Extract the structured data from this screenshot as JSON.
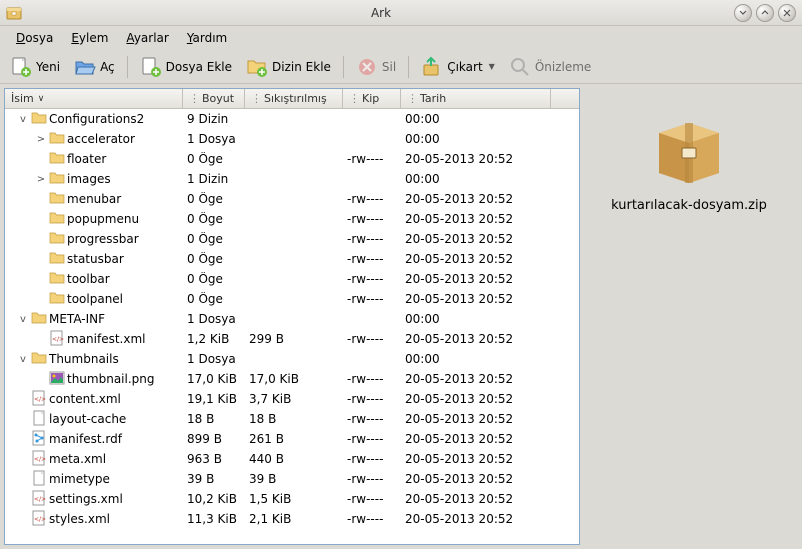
{
  "title": "Ark",
  "menubar": [
    "Dosya",
    "Eylem",
    "Ayarlar",
    "Yardım"
  ],
  "toolbar": {
    "new": "Yeni",
    "open": "Aç",
    "addfile": "Dosya Ekle",
    "adddir": "Dizin Ekle",
    "delete": "Sil",
    "extract": "Çıkart",
    "preview": "Önizleme"
  },
  "columns": {
    "name": "İsim",
    "size": "Boyut",
    "compressed": "Sıkıştırılmış",
    "mode": "Kip",
    "date": "Tarih"
  },
  "archive_name": "kurtarılacak-dosyam.zip",
  "rows": [
    {
      "d": 0,
      "exp": "open",
      "icon": "folder",
      "name": "Configurations2",
      "size": "9 Dizin",
      "comp": "",
      "mode": "",
      "date": "00:00"
    },
    {
      "d": 1,
      "exp": "closed",
      "icon": "folder",
      "name": "accelerator",
      "size": "1 Dosya",
      "comp": "",
      "mode": "",
      "date": "00:00"
    },
    {
      "d": 1,
      "exp": "none",
      "icon": "folder",
      "name": "floater",
      "size": "0 Öge",
      "comp": "",
      "mode": "-rw----",
      "date": "20-05-2013 20:52"
    },
    {
      "d": 1,
      "exp": "closed",
      "icon": "folder",
      "name": "images",
      "size": "1 Dizin",
      "comp": "",
      "mode": "",
      "date": "00:00"
    },
    {
      "d": 1,
      "exp": "none",
      "icon": "folder",
      "name": "menubar",
      "size": "0 Öge",
      "comp": "",
      "mode": "-rw----",
      "date": "20-05-2013 20:52"
    },
    {
      "d": 1,
      "exp": "none",
      "icon": "folder",
      "name": "popupmenu",
      "size": "0 Öge",
      "comp": "",
      "mode": "-rw----",
      "date": "20-05-2013 20:52"
    },
    {
      "d": 1,
      "exp": "none",
      "icon": "folder",
      "name": "progressbar",
      "size": "0 Öge",
      "comp": "",
      "mode": "-rw----",
      "date": "20-05-2013 20:52"
    },
    {
      "d": 1,
      "exp": "none",
      "icon": "folder",
      "name": "statusbar",
      "size": "0 Öge",
      "comp": "",
      "mode": "-rw----",
      "date": "20-05-2013 20:52"
    },
    {
      "d": 1,
      "exp": "none",
      "icon": "folder",
      "name": "toolbar",
      "size": "0 Öge",
      "comp": "",
      "mode": "-rw----",
      "date": "20-05-2013 20:52"
    },
    {
      "d": 1,
      "exp": "none",
      "icon": "folder",
      "name": "toolpanel",
      "size": "0 Öge",
      "comp": "",
      "mode": "-rw----",
      "date": "20-05-2013 20:52"
    },
    {
      "d": 0,
      "exp": "open",
      "icon": "folder",
      "name": "META-INF",
      "size": "1 Dosya",
      "comp": "",
      "mode": "",
      "date": "00:00"
    },
    {
      "d": 1,
      "exp": "none",
      "icon": "xml",
      "name": "manifest.xml",
      "size": "1,2 KiB",
      "comp": "299 B",
      "mode": "-rw----",
      "date": "20-05-2013 20:52"
    },
    {
      "d": 0,
      "exp": "open",
      "icon": "folder",
      "name": "Thumbnails",
      "size": "1 Dosya",
      "comp": "",
      "mode": "",
      "date": "00:00"
    },
    {
      "d": 1,
      "exp": "none",
      "icon": "png",
      "name": "thumbnail.png",
      "size": "17,0 KiB",
      "comp": "17,0 KiB",
      "mode": "-rw----",
      "date": "20-05-2013 20:52"
    },
    {
      "d": 0,
      "exp": "none",
      "icon": "xml",
      "name": "content.xml",
      "size": "19,1 KiB",
      "comp": "3,7 KiB",
      "mode": "-rw----",
      "date": "20-05-2013 20:52"
    },
    {
      "d": 0,
      "exp": "none",
      "icon": "file",
      "name": "layout-cache",
      "size": "18 B",
      "comp": "18 B",
      "mode": "-rw----",
      "date": "20-05-2013 20:52"
    },
    {
      "d": 0,
      "exp": "none",
      "icon": "rdf",
      "name": "manifest.rdf",
      "size": "899 B",
      "comp": "261 B",
      "mode": "-rw----",
      "date": "20-05-2013 20:52"
    },
    {
      "d": 0,
      "exp": "none",
      "icon": "xml",
      "name": "meta.xml",
      "size": "963 B",
      "comp": "440 B",
      "mode": "-rw----",
      "date": "20-05-2013 20:52"
    },
    {
      "d": 0,
      "exp": "none",
      "icon": "file",
      "name": "mimetype",
      "size": "39 B",
      "comp": "39 B",
      "mode": "-rw----",
      "date": "20-05-2013 20:52"
    },
    {
      "d": 0,
      "exp": "none",
      "icon": "xml",
      "name": "settings.xml",
      "size": "10,2 KiB",
      "comp": "1,5 KiB",
      "mode": "-rw----",
      "date": "20-05-2013 20:52"
    },
    {
      "d": 0,
      "exp": "none",
      "icon": "xml",
      "name": "styles.xml",
      "size": "11,3 KiB",
      "comp": "2,1 KiB",
      "mode": "-rw----",
      "date": "20-05-2013 20:52"
    }
  ]
}
